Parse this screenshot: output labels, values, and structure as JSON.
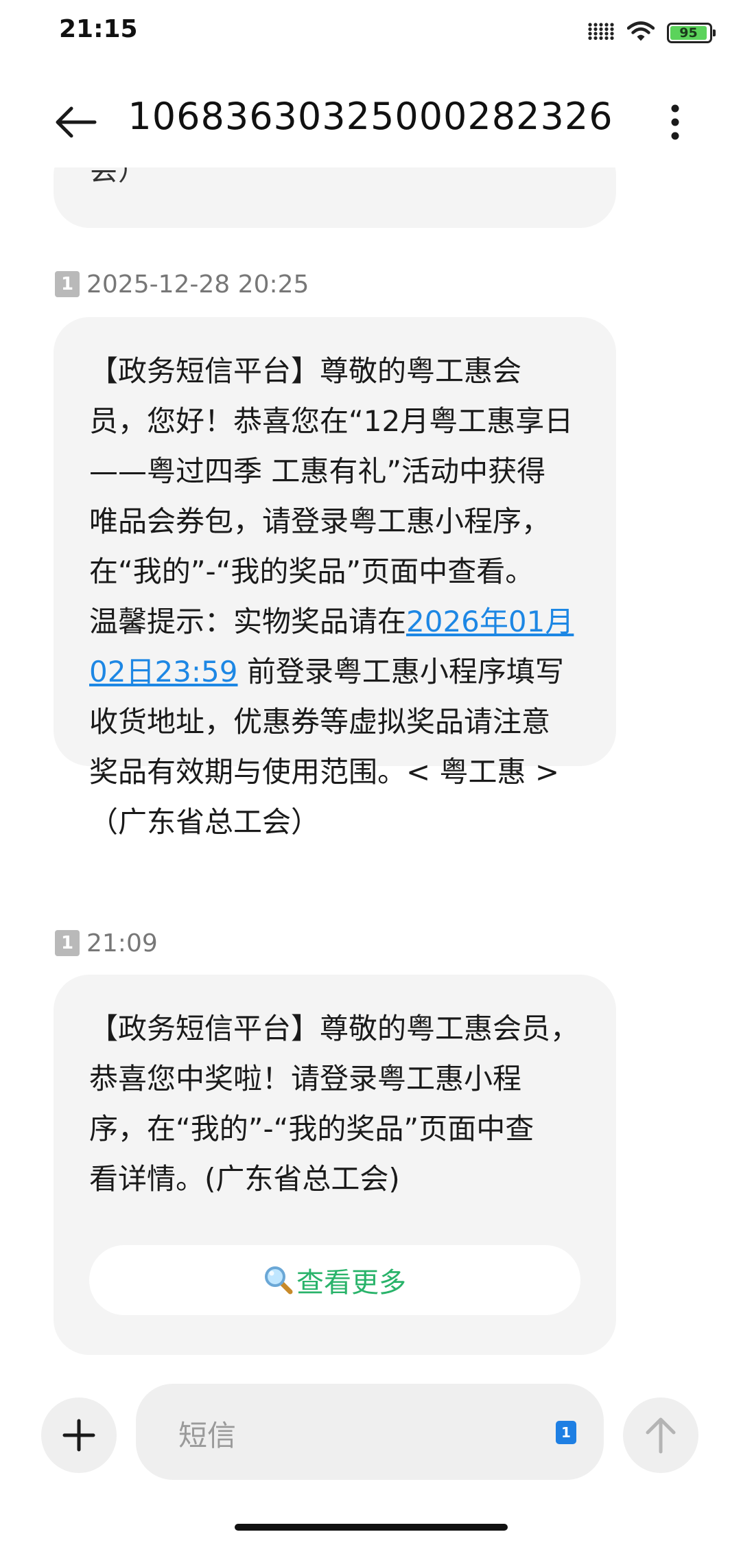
{
  "status_bar": {
    "time": "21:15",
    "battery": "95",
    "icons": [
      "signal-icon",
      "wifi-icon",
      "battery-icon"
    ]
  },
  "header": {
    "title": "1068363032500028​2326",
    "back_icon": "arrow-left-icon",
    "more_icon": "more-vertical-icon"
  },
  "messages": [
    {
      "partial_text": "会）"
    },
    {
      "sim": "1",
      "time": "2025-12-28 20:25",
      "text_before": "【政务短信平台】尊敬的粤工惠会\n员，您好！恭喜您在“12月粤工惠享日\n——粤过四季 工惠有礼”活动中获得\n唯品会券包，请登录粤工惠小程序，\n在“我的”-“我的奖品”页面中查看。\n温馨提示：实物奖品请在",
      "link": "2026年01月\n02日23:59",
      "text_after": " 前登录粤工惠小程序填写\n收货地址，优惠券等虚拟奖品请注意\n奖品有效期与使用范围。< 粤工惠 >\n（广东省总工会）"
    },
    {
      "sim": "1",
      "time": "21:09",
      "text": "【政务短信平台】尊敬的粤工惠会员，\n恭喜您中奖啦！请登录粤工惠小程\n序，在“我的”-“我的奖品”页面中查\n看详情。(广东省总工会)",
      "button_label": "查看更多",
      "button_icon": "magnifier-icon"
    }
  ],
  "composer": {
    "placeholder": "短信",
    "sim": "1",
    "add_icon": "plus-icon",
    "send_icon": "arrow-up-icon"
  },
  "colors": {
    "link": "#1d87e4",
    "view_more": "#29b36a",
    "bubble": "#f4f4f4",
    "battery": "#5bd35b",
    "sim_select": "#1e7fe3"
  }
}
